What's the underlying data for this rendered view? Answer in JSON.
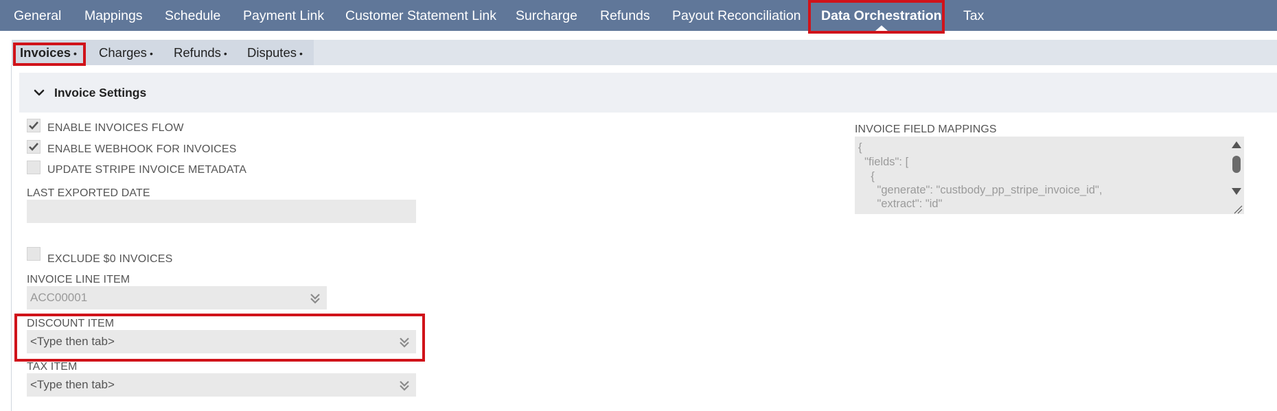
{
  "top_tabs": [
    {
      "label": "General",
      "active": false
    },
    {
      "label": "Mappings",
      "active": false
    },
    {
      "label": "Schedule",
      "active": false
    },
    {
      "label": "Payment Link",
      "active": false
    },
    {
      "label": "Customer Statement Link",
      "active": false
    },
    {
      "label": "Surcharge",
      "active": false
    },
    {
      "label": "Refunds",
      "active": false
    },
    {
      "label": "Payout Reconciliation",
      "active": false
    },
    {
      "label": "Data Orchestration",
      "active": true
    },
    {
      "label": "Tax",
      "active": false
    }
  ],
  "sub_tabs": [
    {
      "label": "Invoices",
      "dot": "•",
      "active": true
    },
    {
      "label": "Charges",
      "dot": "•",
      "active": false
    },
    {
      "label": "Refunds",
      "dot": "•",
      "active": false
    },
    {
      "label": "Disputes",
      "dot": "•",
      "active": false
    }
  ],
  "section": {
    "title": "Invoice Settings",
    "icon": "chevron-down-icon"
  },
  "checkboxes": {
    "enable_invoices_flow": {
      "label": "ENABLE INVOICES FLOW",
      "checked": true
    },
    "enable_webhook": {
      "label": "ENABLE WEBHOOK FOR INVOICES",
      "checked": true
    },
    "update_metadata": {
      "label": "UPDATE STRIPE INVOICE METADATA",
      "checked": false
    },
    "exclude_zero": {
      "label": "EXCLUDE $0 INVOICES",
      "checked": false
    }
  },
  "fields": {
    "last_exported_date": {
      "label": "LAST EXPORTED DATE",
      "value": ""
    },
    "invoice_line_item": {
      "label": "INVOICE LINE ITEM",
      "value": "ACC00001"
    },
    "discount_item": {
      "label": "DISCOUNT ITEM",
      "placeholder": "<Type then tab>"
    },
    "tax_item": {
      "label": "TAX ITEM",
      "placeholder": "<Type then tab>"
    }
  },
  "field_mappings": {
    "label": "INVOICE FIELD MAPPINGS",
    "lines": [
      "{",
      "  \"fields\": [",
      "    {",
      "      \"generate\": \"custbody_pp_stripe_invoice_id\",",
      "      \"extract\": \"id\""
    ]
  },
  "colors": {
    "topbar": "#607799",
    "highlight": "#d0131a",
    "field_bg": "#e9e9e9"
  }
}
